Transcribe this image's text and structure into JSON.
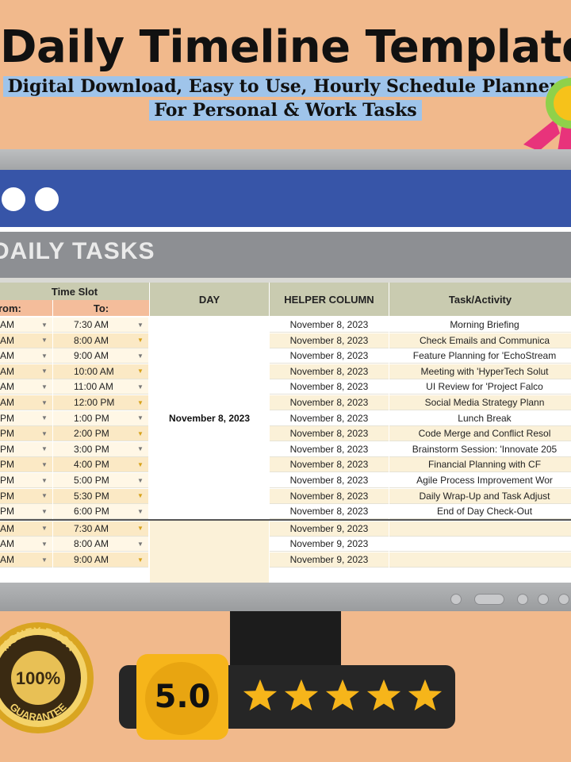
{
  "header": {
    "title": "Daily Timeline Template",
    "subtitle_line1": "Digital Download, Easy to Use, Hourly Schedule Planner,",
    "subtitle_line2": "For Personal & Work Tasks"
  },
  "sheet": {
    "title": "DAILY TASKS",
    "columns": {
      "time_slot": "Time Slot",
      "from": "From:",
      "to": "To:",
      "day": "DAY",
      "helper": "HELPER COLUMN",
      "task": "Task/Activity"
    },
    "day_group_label": "November 8, 2023",
    "rows": [
      {
        "from": "AM",
        "to": "7:30 AM",
        "helper": "November 8, 2023",
        "task": "Morning Briefing"
      },
      {
        "from": "AM",
        "to": "8:00 AM",
        "helper": "November 8, 2023",
        "task": "Check Emails and Communica"
      },
      {
        "from": "AM",
        "to": "9:00 AM",
        "helper": "November 8, 2023",
        "task": "Feature Planning for 'EchoStream"
      },
      {
        "from": "AM",
        "to": "10:00 AM",
        "helper": "November 8, 2023",
        "task": "Meeting with 'HyperTech Solut"
      },
      {
        "from": "AM",
        "to": "11:00 AM",
        "helper": "November 8, 2023",
        "task": "UI Review for 'Project Falco"
      },
      {
        "from": "AM",
        "to": "12:00 PM",
        "helper": "November 8, 2023",
        "task": "Social Media Strategy Plann"
      },
      {
        "from": "PM",
        "to": "1:00 PM",
        "helper": "November 8, 2023",
        "task": "Lunch Break"
      },
      {
        "from": "PM",
        "to": "2:00 PM",
        "helper": "November 8, 2023",
        "task": "Code Merge and Conflict Resol"
      },
      {
        "from": "PM",
        "to": "3:00 PM",
        "helper": "November 8, 2023",
        "task": "Brainstorm Session: 'Innovate 205"
      },
      {
        "from": "PM",
        "to": "4:00 PM",
        "helper": "November 8, 2023",
        "task": "Financial Planning with CF"
      },
      {
        "from": "PM",
        "to": "5:00 PM",
        "helper": "November 8, 2023",
        "task": "Agile Process Improvement Wor"
      },
      {
        "from": "PM",
        "to": "5:30 PM",
        "helper": "November 8, 2023",
        "task": "Daily Wrap-Up and Task Adjust"
      },
      {
        "from": "PM",
        "to": "6:00 PM",
        "helper": "November 8, 2023",
        "task": "End of Day Check-Out"
      },
      {
        "from": "AM",
        "to": "7:30 AM",
        "helper": "November 9, 2023",
        "task": ""
      },
      {
        "from": "AM",
        "to": "8:00 AM",
        "helper": "November 9, 2023",
        "task": ""
      },
      {
        "from": "AM",
        "to": "9:00 AM",
        "helper": "November 9, 2023",
        "task": ""
      }
    ]
  },
  "guarantee": {
    "line1": "MONEY BACK",
    "pct": "100%",
    "line2": "GUARANTEE"
  },
  "rating": {
    "value": "5.0",
    "stars": 5
  },
  "colors": {
    "background": "#f1b98c",
    "window_bar": "#3755a8",
    "rating_yellow": "#f6b51a"
  }
}
